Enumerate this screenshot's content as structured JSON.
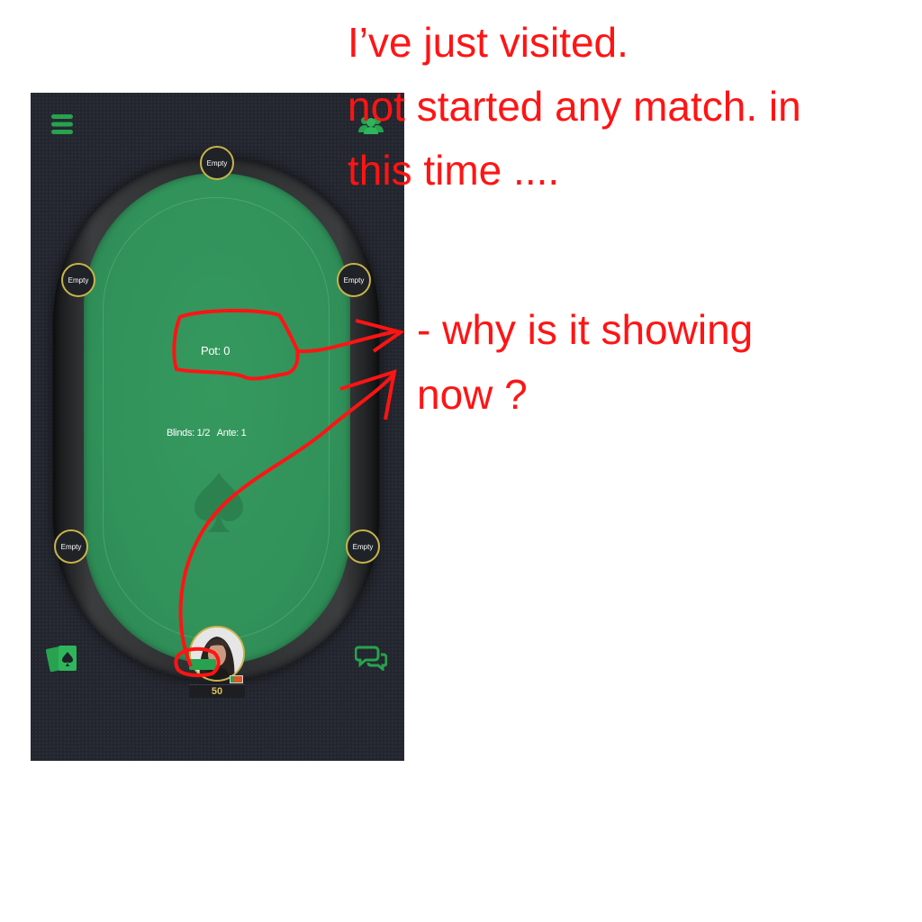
{
  "seats": {
    "top": "Empty",
    "upper_left": "Empty",
    "upper_right": "Empty",
    "lower_left": "Empty",
    "lower_right": "Empty"
  },
  "table": {
    "pot": "Pot: 0",
    "blinds": "Blinds: 1/2   Ante: 1"
  },
  "player": {
    "stack": "50"
  },
  "icons": {
    "menu": "hamburger-menu-icon",
    "players": "users-group-icon",
    "cards": "playing-cards-icon",
    "chat": "chat-bubbles-icon",
    "watermark": "spade-icon"
  },
  "annotations": {
    "line1": "I’ve just visited.",
    "line2": "not started any match. in",
    "line3": "this time ....",
    "question1": "- why is it showing",
    "question2": "now ?"
  },
  "colors": {
    "felt": "#31925a",
    "accent": "#27a24f",
    "seat_border": "#c9b34a",
    "annotation": "#ff1414"
  }
}
